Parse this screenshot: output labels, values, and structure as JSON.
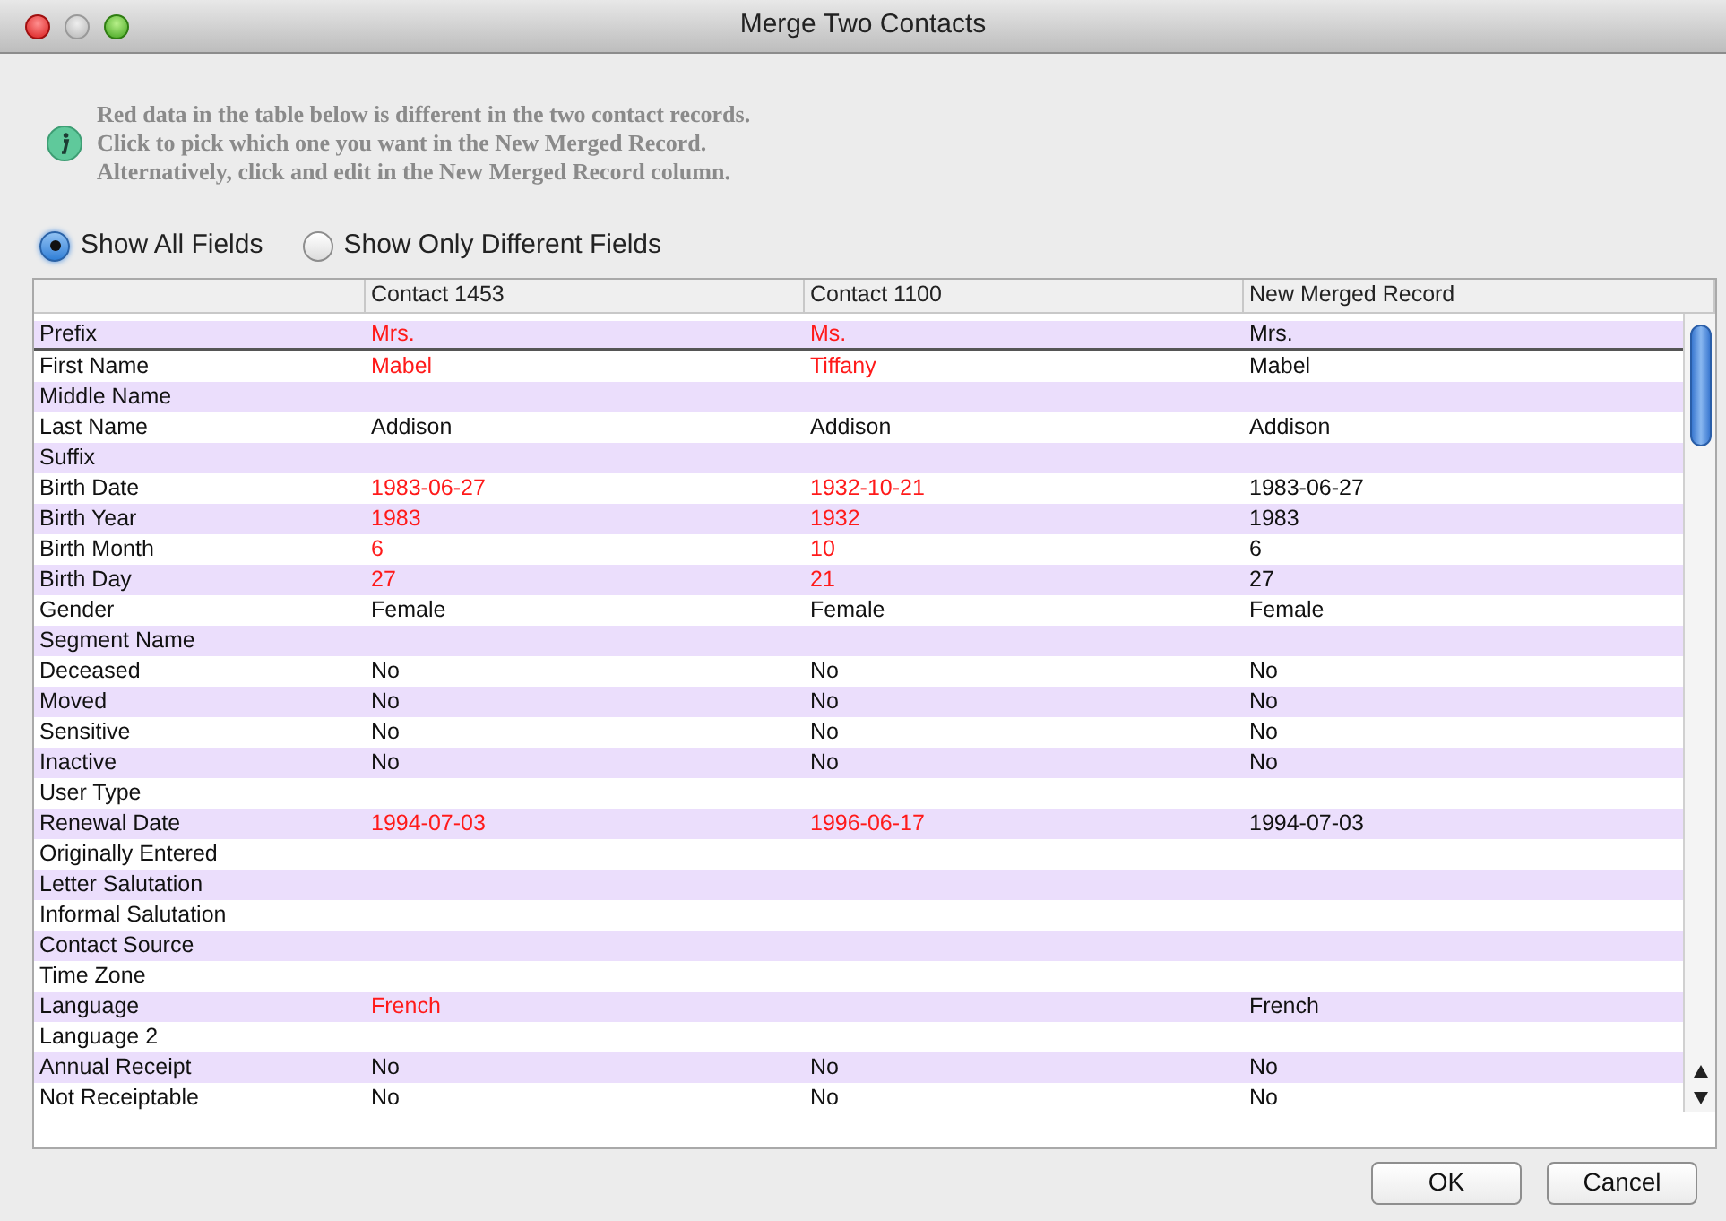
{
  "window": {
    "title": "Merge Two Contacts"
  },
  "info": [
    "Red data in the table below is different in the two contact records.",
    "Click to pick which one you want in the New Merged Record.",
    "Alternatively, click and edit in the New Merged Record column."
  ],
  "filters": [
    {
      "label": "Show All Fields",
      "selected": true
    },
    {
      "label": "Show Only Different Fields",
      "selected": false
    }
  ],
  "table": {
    "columns": [
      "Contact 1453",
      "Contact 1100",
      "New Merged Record"
    ],
    "rows": [
      {
        "field": "Prefix",
        "contact_1": "Mrs.",
        "contact_2": "Ms.",
        "merged": "Mrs.",
        "different": true,
        "selected": true
      },
      {
        "field": "First Name",
        "contact_1": "Mabel",
        "contact_2": "Tiffany",
        "merged": "Mabel",
        "different": true,
        "selected": false
      },
      {
        "field": "Middle Name",
        "contact_1": "",
        "contact_2": "",
        "merged": "",
        "different": false,
        "selected": false
      },
      {
        "field": "Last Name",
        "contact_1": "Addison",
        "contact_2": "Addison",
        "merged": "Addison",
        "different": false,
        "selected": false
      },
      {
        "field": "Suffix",
        "contact_1": "",
        "contact_2": "",
        "merged": "",
        "different": false,
        "selected": false
      },
      {
        "field": "Birth Date",
        "contact_1": "1983-06-27",
        "contact_2": "1932-10-21",
        "merged": "1983-06-27",
        "different": true,
        "selected": false
      },
      {
        "field": "Birth Year",
        "contact_1": "1983",
        "contact_2": "1932",
        "merged": "1983",
        "different": true,
        "selected": false
      },
      {
        "field": "Birth Month",
        "contact_1": "6",
        "contact_2": "10",
        "merged": "6",
        "different": true,
        "selected": false
      },
      {
        "field": "Birth Day",
        "contact_1": "27",
        "contact_2": "21",
        "merged": "27",
        "different": true,
        "selected": false
      },
      {
        "field": "Gender",
        "contact_1": "Female",
        "contact_2": "Female",
        "merged": "Female",
        "different": false,
        "selected": false
      },
      {
        "field": "Segment Name",
        "contact_1": "",
        "contact_2": "",
        "merged": "",
        "different": false,
        "selected": false
      },
      {
        "field": "Deceased",
        "contact_1": "No",
        "contact_2": "No",
        "merged": "No",
        "different": false,
        "selected": false
      },
      {
        "field": "Moved",
        "contact_1": "No",
        "contact_2": "No",
        "merged": "No",
        "different": false,
        "selected": false
      },
      {
        "field": "Sensitive",
        "contact_1": "No",
        "contact_2": "No",
        "merged": "No",
        "different": false,
        "selected": false
      },
      {
        "field": "Inactive",
        "contact_1": "No",
        "contact_2": "No",
        "merged": "No",
        "different": false,
        "selected": false
      },
      {
        "field": "User Type",
        "contact_1": "",
        "contact_2": "",
        "merged": "",
        "different": false,
        "selected": false
      },
      {
        "field": "Renewal Date",
        "contact_1": "1994-07-03",
        "contact_2": "1996-06-17",
        "merged": "1994-07-03",
        "different": true,
        "selected": false
      },
      {
        "field": "Originally Entered",
        "contact_1": "",
        "contact_2": "",
        "merged": "",
        "different": false,
        "selected": false
      },
      {
        "field": "Letter Salutation",
        "contact_1": "",
        "contact_2": "",
        "merged": "",
        "different": false,
        "selected": false
      },
      {
        "field": "Informal Salutation",
        "contact_1": "",
        "contact_2": "",
        "merged": "",
        "different": false,
        "selected": false
      },
      {
        "field": "Contact Source",
        "contact_1": "",
        "contact_2": "",
        "merged": "",
        "different": false,
        "selected": false
      },
      {
        "field": "Time Zone",
        "contact_1": "",
        "contact_2": "",
        "merged": "",
        "different": false,
        "selected": false
      },
      {
        "field": "Language",
        "contact_1": "French",
        "contact_2": "",
        "merged": "French",
        "different": true,
        "selected": false
      },
      {
        "field": "Language 2",
        "contact_1": "",
        "contact_2": "",
        "merged": "",
        "different": false,
        "selected": false
      },
      {
        "field": "Annual Receipt",
        "contact_1": "No",
        "contact_2": "No",
        "merged": "No",
        "different": false,
        "selected": false
      },
      {
        "field": "Not Receiptable",
        "contact_1": "No",
        "contact_2": "No",
        "merged": "No",
        "different": false,
        "selected": false
      }
    ]
  },
  "buttons": [
    "OK",
    "Cancel"
  ]
}
